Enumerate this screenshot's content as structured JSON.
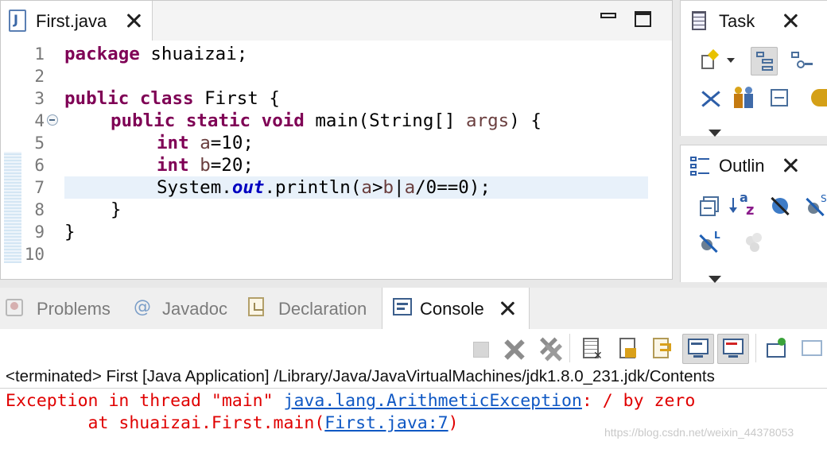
{
  "editor": {
    "tab_title": "First.java",
    "line_numbers": [
      "1",
      "2",
      "3",
      "4",
      "5",
      "6",
      "7",
      "8",
      "9",
      "10"
    ],
    "lines": {
      "l1": {
        "kw": "package",
        "rest": " shuaizai;"
      },
      "l3": {
        "kw1": "public",
        "kw2": "class",
        "rest": " First {"
      },
      "l4": {
        "kw1": "public",
        "kw2": "static",
        "kw3": "void",
        "rest1": " main(String[] ",
        "param": "args",
        "rest2": ") {"
      },
      "l5": {
        "kw": "int",
        "var": "a",
        "rest": "=10;"
      },
      "l6": {
        "kw": "int",
        "var": "b",
        "rest": "=20;"
      },
      "l7": {
        "p1": "System.",
        "field": "out",
        "p2": ".println(",
        "v1": "a",
        "p3": ">",
        "v2": "b",
        "p4": "|",
        "v3": "a",
        "p5": "/0==0);"
      },
      "l8": "}",
      "l9": "}"
    }
  },
  "task_panel": {
    "title": "Task"
  },
  "outline_panel": {
    "title": "Outlin"
  },
  "bottom_tabs": [
    {
      "label": "Problems"
    },
    {
      "label": "Javadoc"
    },
    {
      "label": "Declaration"
    },
    {
      "label": "Console"
    }
  ],
  "console": {
    "status": "<terminated> First [Java Application] /Library/Java/JavaVirtualMachines/jdk1.8.0_231.jdk/Contents",
    "error_prefix": "Exception in thread \"main\" ",
    "error_link": "java.lang.ArithmeticException",
    "error_suffix": ": / by zero",
    "trace_prefix": "        at shuaizai.First.main(",
    "trace_link": "First.java:7",
    "trace_suffix": ")"
  },
  "watermark": "https://blog.csdn.net/weixin_44378053",
  "colors": {
    "keyword": "#7f0055",
    "variable": "#6a3e3e",
    "static_field": "#0000c0",
    "error": "#e00000",
    "link": "#0f58c4",
    "current_line": "#e8f1fa"
  }
}
